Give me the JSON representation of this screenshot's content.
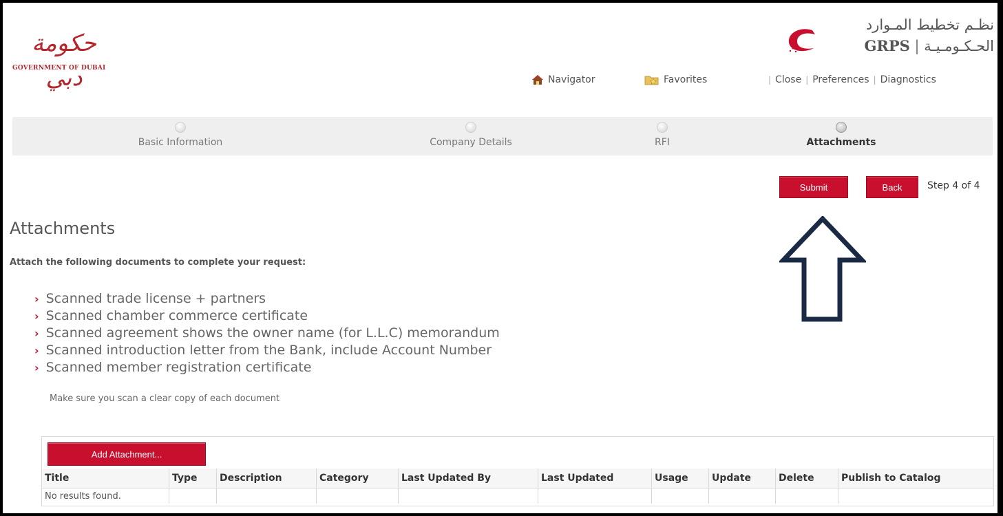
{
  "header": {
    "gov_logo_arabic": "حكومة دبي",
    "gov_logo_english": "GOVERNMENT OF DUBAI",
    "grps_logo_arabic_line1": "نظـم تخطيط المـوارد",
    "grps_logo_latin": "GRPS",
    "grps_logo_arabic_line2": "الحـكـومـيـة"
  },
  "topnav": {
    "navigator": "Navigator",
    "favorites": "Favorites",
    "close": "Close",
    "preferences": "Preferences",
    "diagnostics": "Diagnostics",
    "separator": "|"
  },
  "train": {
    "stops": [
      {
        "label": "Basic Information",
        "active": false
      },
      {
        "label": "Company Details",
        "active": false
      },
      {
        "label": "RFI",
        "active": false
      },
      {
        "label": "Attachments",
        "active": true
      }
    ]
  },
  "actions": {
    "submit": "Submit",
    "back": "Back",
    "step": "Step 4 of 4"
  },
  "main": {
    "title": "Attachments",
    "instructions": "Attach the following documents to complete your request:",
    "documents": [
      "Scanned trade license + partners",
      "Scanned chamber commerce certificate",
      "Scanned agreement shows the owner name (for L.L.C) memorandum",
      "Scanned introduction letter from the Bank, include Account Number",
      "Scanned member registration certificate"
    ],
    "note": "Make sure you scan a clear copy of each document"
  },
  "attachments_table": {
    "add_button": "Add Attachment...",
    "columns": [
      "Title",
      "Type",
      "Description",
      "Category",
      "Last Updated By",
      "Last Updated",
      "Usage",
      "Update",
      "Delete",
      "Publish to Catalog"
    ],
    "empty_message": "No results found."
  },
  "colors": {
    "accent": "#c8102e",
    "annotation_arrow": "#1b2a44"
  }
}
